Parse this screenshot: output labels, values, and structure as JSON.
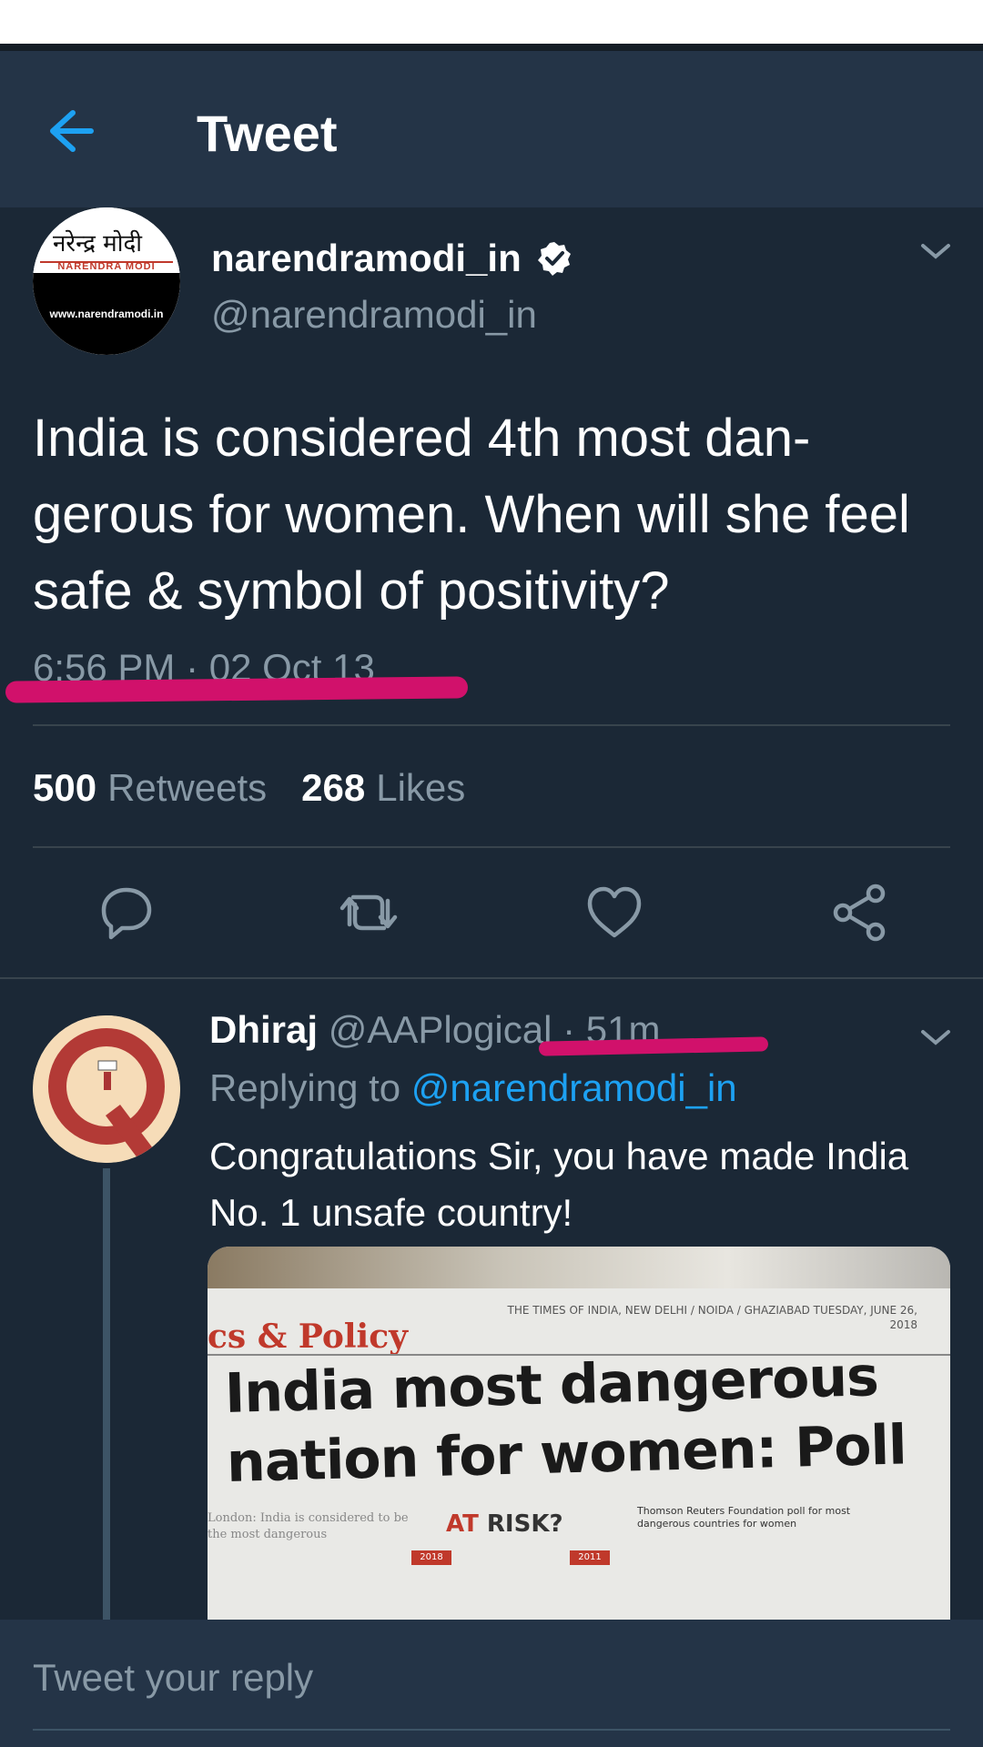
{
  "header": {
    "title": "Tweet"
  },
  "tweet": {
    "display_name": "narendramodi_in",
    "handle": "@narendramodi_in",
    "avatar_text": {
      "top": "नरेन्द्र मोदी",
      "banner": "NARENDRA MODI",
      "url": "www.narendramodi.in"
    },
    "text": "India is considered 4th most dan-gerous for women. When will she feel safe & symbol of positivity?",
    "timestamp": "6:56 PM · 02 Oct 13",
    "retweets_count": "500",
    "retweets_label": "Retweets",
    "likes_count": "268",
    "likes_label": "Likes"
  },
  "reply": {
    "display_name": "Dhiraj",
    "handle": "@AAPlogical",
    "time": " · 51m",
    "replying_prefix": "Replying to ",
    "replying_to": "@narendramodi_in",
    "text": "Congratulations Sir, you have made India No. 1 unsafe country!",
    "media": {
      "section": "cs & Policy",
      "dateline": "THE TIMES OF INDIA, NEW DELHI / NOIDA / GHAZIABAD TUESDAY, JUNE 26, 2018",
      "headline_line1": "India most dangerous",
      "headline_line2": "nation for women: Poll",
      "at": "AT",
      "risk": " RISK?",
      "caption": "Thomson Reuters Foundation poll for most dangerous countries for women",
      "body_text": "London: India is considered to be the most dangerous",
      "year1": "2018",
      "year2": "2011"
    }
  },
  "composer": {
    "placeholder": "Tweet your reply"
  },
  "colors": {
    "accent": "#1da1f2",
    "highlight": "#d1116b",
    "background": "#1b2836",
    "header": "#243447"
  },
  "icons": [
    "back-arrow-icon",
    "verified-badge-icon",
    "chevron-down-icon",
    "reply-icon",
    "retweet-icon",
    "like-icon",
    "share-icon"
  ]
}
